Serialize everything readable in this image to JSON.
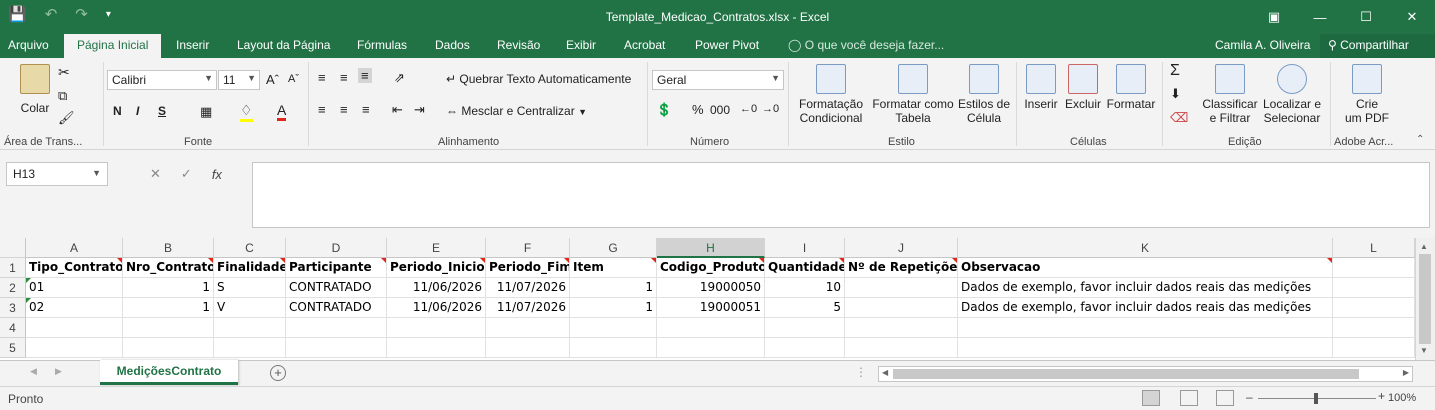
{
  "window": {
    "title": "Template_Medicao_Contratos.xlsx - Excel"
  },
  "tabs": [
    "Arquivo",
    "Página Inicial",
    "Inserir",
    "Layout da Página",
    "Fórmulas",
    "Dados",
    "Revisão",
    "Exibir",
    "Acrobat",
    "Power Pivot"
  ],
  "active_tab": "Página Inicial",
  "tell_me": "O que você deseja fazer...",
  "user": "Camila A. Oliveira",
  "share": "Compartilhar",
  "ribbon": {
    "clipboard": {
      "paste": "Colar",
      "label": "Área de Trans..."
    },
    "font": {
      "name": "Calibri",
      "size": "11",
      "label": "Fonte",
      "bold": "N",
      "italic": "I",
      "underline": "S"
    },
    "alignment": {
      "wrap": "Quebrar Texto Automaticamente",
      "merge": "Mesclar e Centralizar",
      "label": "Alinhamento"
    },
    "number": {
      "format": "Geral",
      "label": "Número"
    },
    "styles": {
      "conditional_1": "Formatação",
      "conditional_2": "Condicional",
      "table_1": "Formatar como",
      "table_2": "Tabela",
      "cell_1": "Estilos de",
      "cell_2": "Célula",
      "label": "Estilo"
    },
    "cells": {
      "insert": "Inserir",
      "delete": "Excluir",
      "format": "Formatar",
      "label": "Células"
    },
    "editing": {
      "sort_1": "Classificar",
      "sort_2": "e Filtrar",
      "find_1": "Localizar e",
      "find_2": "Selecionar",
      "label": "Edição"
    },
    "adobe": {
      "pdf_1": "Crie",
      "pdf_2": "um PDF",
      "label": "Adobe Acr..."
    }
  },
  "namebox": "H13",
  "formula": "",
  "columns": [
    {
      "letter": "A"
    },
    {
      "letter": "B"
    },
    {
      "letter": "C"
    },
    {
      "letter": "D"
    },
    {
      "letter": "E"
    },
    {
      "letter": "F"
    },
    {
      "letter": "G"
    },
    {
      "letter": "H"
    },
    {
      "letter": "I"
    },
    {
      "letter": "J"
    },
    {
      "letter": "K"
    },
    {
      "letter": "L"
    }
  ],
  "rows": [
    "1",
    "2",
    "3",
    "4",
    "5"
  ],
  "header_row": [
    "Tipo_Contrato",
    "Nro_Contrato",
    "Finalidade",
    "Participante",
    "Periodo_Inicio",
    "Periodo_Fim",
    "Item",
    "Codigo_Produto",
    "Quantidade",
    "Nº de Repetições",
    "Observacao",
    ""
  ],
  "data_rows": [
    [
      "01",
      "1",
      "S",
      "CONTRATADO",
      "11/06/2026",
      "11/07/2026",
      "1",
      "19000050",
      "10",
      "",
      "Dados de exemplo, favor incluir dados reais das medições",
      ""
    ],
    [
      "02",
      "1",
      "V",
      "CONTRATADO",
      "11/06/2026",
      "11/07/2026",
      "1",
      "19000051",
      "5",
      "",
      "Dados de exemplo, favor incluir dados reais das medições",
      ""
    ]
  ],
  "sheet_tab": "MediçõesContrato",
  "status": "Pronto",
  "zoom": "100%"
}
